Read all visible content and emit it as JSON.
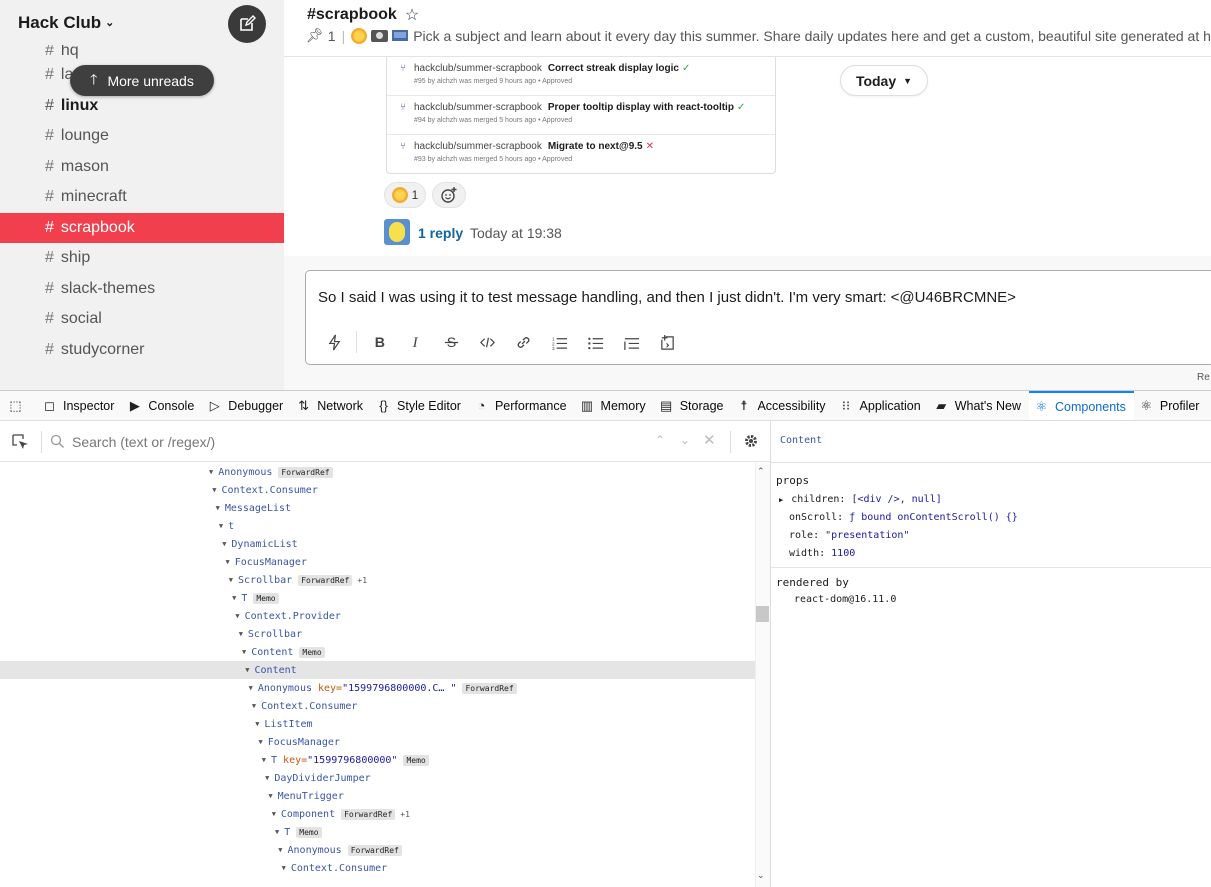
{
  "workspace": {
    "name": "Hack Club",
    "chevron": "⌄"
  },
  "sidebar": {
    "more_unreads": "More unreads",
    "channels": [
      {
        "name": "hq",
        "style": "normal"
      },
      {
        "name": "lachlanfiller",
        "style": "normal"
      },
      {
        "name": "linux",
        "style": "bold"
      },
      {
        "name": "lounge",
        "style": "normal"
      },
      {
        "name": "mason",
        "style": "normal"
      },
      {
        "name": "minecraft",
        "style": "normal"
      },
      {
        "name": "scrapbook",
        "style": "active"
      },
      {
        "name": "ship",
        "style": "normal"
      },
      {
        "name": "slack-themes",
        "style": "normal"
      },
      {
        "name": "social",
        "style": "normal"
      },
      {
        "name": "studycorner",
        "style": "normal"
      }
    ]
  },
  "channel": {
    "title": "#scrapbook",
    "pins": "1",
    "description": "Pick a subject and learn about it every day this summer. Share daily updates here and get a custom, beautiful site generated at ht."
  },
  "messages": {
    "pull_requests": [
      {
        "repo": "hackclub/summer-scrapbook",
        "title": "Correct streak display logic",
        "status": "ok",
        "meta": "#95 by alchzh was merged 9 hours ago • Approved"
      },
      {
        "repo": "hackclub/summer-scrapbook",
        "title": "Proper tooltip display with react-tooltip",
        "status": "ok",
        "meta": "#94 by alchzh was merged 5 hours ago • Approved"
      },
      {
        "repo": "hackclub/summer-scrapbook",
        "title": "Migrate to next@9.5",
        "status": "fail",
        "meta": "#93 by alchzh was merged 5 hours ago • Approved"
      }
    ],
    "today_label": "Today",
    "reaction_count": "1",
    "reply_count": "1 reply",
    "reply_time": "Today at 19:38"
  },
  "composer": {
    "text": "So I said I was using it to test message handling, and then I just didn't. I'm very smart: <@U46BRCMNE>",
    "trailing": "Re"
  },
  "devtools": {
    "tabs": [
      {
        "label": "",
        "icon": "picker-icon"
      },
      {
        "label": "Inspector",
        "icon": "inspector-icon"
      },
      {
        "label": "Console",
        "icon": "console-icon"
      },
      {
        "label": "Debugger",
        "icon": "debugger-icon"
      },
      {
        "label": "Network",
        "icon": "network-icon"
      },
      {
        "label": "Style Editor",
        "icon": "style-editor-icon"
      },
      {
        "label": "Performance",
        "icon": "performance-icon"
      },
      {
        "label": "Memory",
        "icon": "memory-icon"
      },
      {
        "label": "Storage",
        "icon": "storage-icon"
      },
      {
        "label": "Accessibility",
        "icon": "accessibility-icon"
      },
      {
        "label": "Application",
        "icon": "application-icon"
      },
      {
        "label": "What's New",
        "icon": "whats-new-icon"
      },
      {
        "label": "Components",
        "icon": "react-icon",
        "active": true
      },
      {
        "label": "Profiler",
        "icon": "react-icon"
      }
    ],
    "search_placeholder": "Search (text or /regex/)",
    "tree": [
      {
        "depth": 0,
        "name": "Anonymous",
        "badge": "ForwardRef"
      },
      {
        "depth": 1,
        "name": "Context.Consumer"
      },
      {
        "depth": 2,
        "name": "MessageList"
      },
      {
        "depth": 3,
        "name": "t"
      },
      {
        "depth": 4,
        "name": "DynamicList"
      },
      {
        "depth": 5,
        "name": "FocusManager"
      },
      {
        "depth": 6,
        "name": "Scrollbar",
        "badge": "ForwardRef",
        "plus": "+1"
      },
      {
        "depth": 7,
        "name": "T",
        "badge": "Memo"
      },
      {
        "depth": 8,
        "name": "Context.Provider"
      },
      {
        "depth": 9,
        "name": "Scrollbar"
      },
      {
        "depth": 10,
        "name": "Content",
        "badge": "Memo"
      },
      {
        "depth": 11,
        "name": "Content",
        "selected": true
      },
      {
        "depth": 12,
        "name": "Anonymous",
        "key": "\"1599796800000.C… \"",
        "badge": "ForwardRef"
      },
      {
        "depth": 13,
        "name": "Context.Consumer"
      },
      {
        "depth": 14,
        "name": "ListItem"
      },
      {
        "depth": 15,
        "name": "FocusManager"
      },
      {
        "depth": 16,
        "name": "T",
        "key": "\"1599796800000\"",
        "badge": "Memo"
      },
      {
        "depth": 17,
        "name": "DayDividerJumper"
      },
      {
        "depth": 18,
        "name": "MenuTrigger"
      },
      {
        "depth": 19,
        "name": "Component",
        "badge": "ForwardRef",
        "plus": "+1"
      },
      {
        "depth": 20,
        "name": "T",
        "badge": "Memo"
      },
      {
        "depth": 21,
        "name": "Anonymous",
        "badge": "ForwardRef"
      },
      {
        "depth": 22,
        "name": "Context.Consumer"
      }
    ],
    "selected_component": "Content",
    "props_label": "props",
    "props": [
      {
        "name": "children:",
        "value": "[<div />, null]",
        "expandable": true
      },
      {
        "name": "onScroll:",
        "value": "ƒ bound onContentScroll() {}"
      },
      {
        "name": "role:",
        "value": "\"presentation\""
      },
      {
        "name": "width:",
        "value": "1100"
      }
    ],
    "rendered_by_label": "rendered by",
    "rendered_by": "react-dom@16.11.0"
  },
  "colors": {
    "active_channel": "#f23f4d",
    "link": "#1264a3",
    "devtools_active": "#0a6bd6"
  }
}
